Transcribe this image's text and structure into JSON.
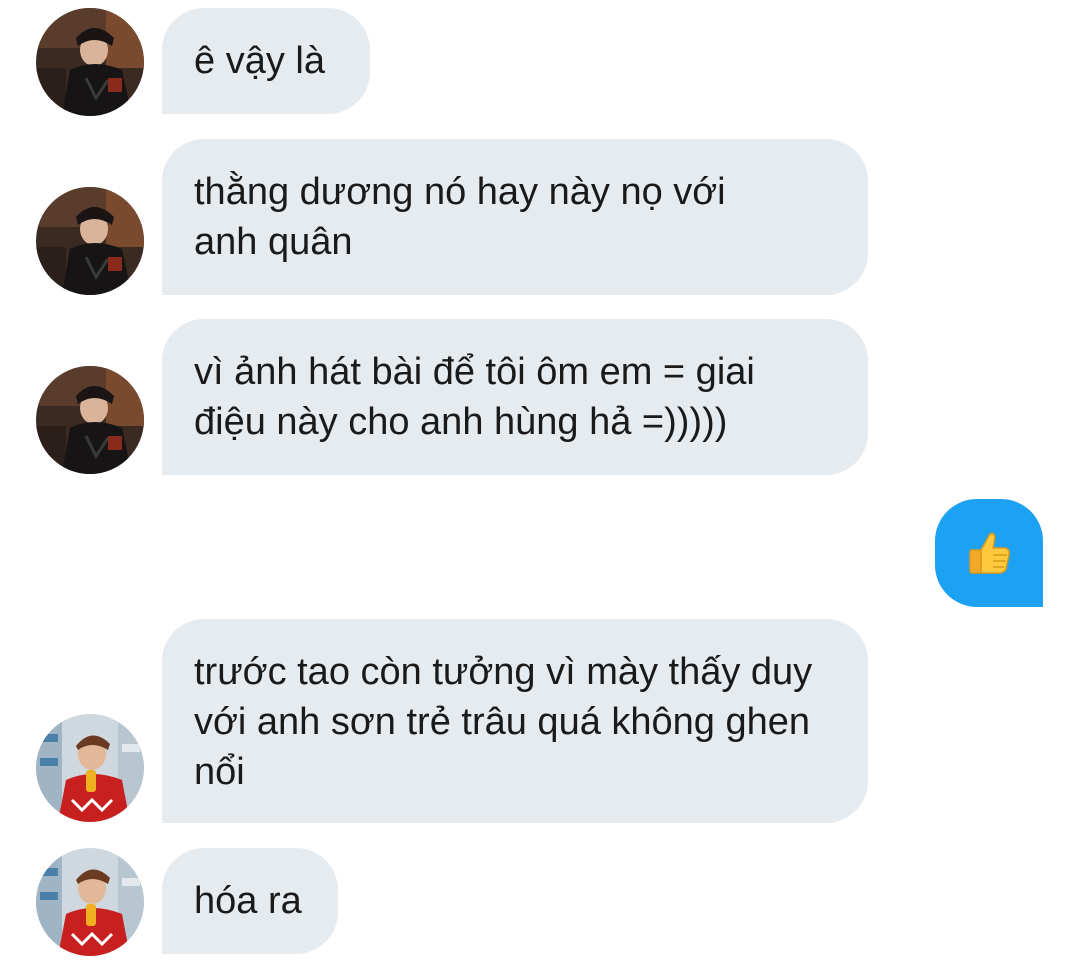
{
  "messages": [
    {
      "sender": "friend_a",
      "text": "ê vậy là"
    },
    {
      "sender": "friend_a",
      "text": "thằng dương nó hay này nọ với anh quân"
    },
    {
      "sender": "friend_a",
      "text": "vì ảnh hát bài để tôi ôm em = giai điệu này cho anh hùng hả =)))))"
    },
    {
      "sender": "me",
      "text": "",
      "emoji": "👍"
    },
    {
      "sender": "friend_b",
      "text": "trước tao còn tưởng vì mày thấy duy với anh sơn trẻ trâu quá không ghen nổi"
    },
    {
      "sender": "friend_b",
      "text": "hóa ra"
    }
  ],
  "colors": {
    "incoming_bubble": "#e6ebf0",
    "outgoing_bubble": "#1da1f2",
    "text": "#1a1a1a"
  },
  "icons": {
    "thumbs_up": "thumbs-up-emoji",
    "avatar_a": "avatar-dark-jacket",
    "avatar_b": "avatar-red-sweater"
  }
}
